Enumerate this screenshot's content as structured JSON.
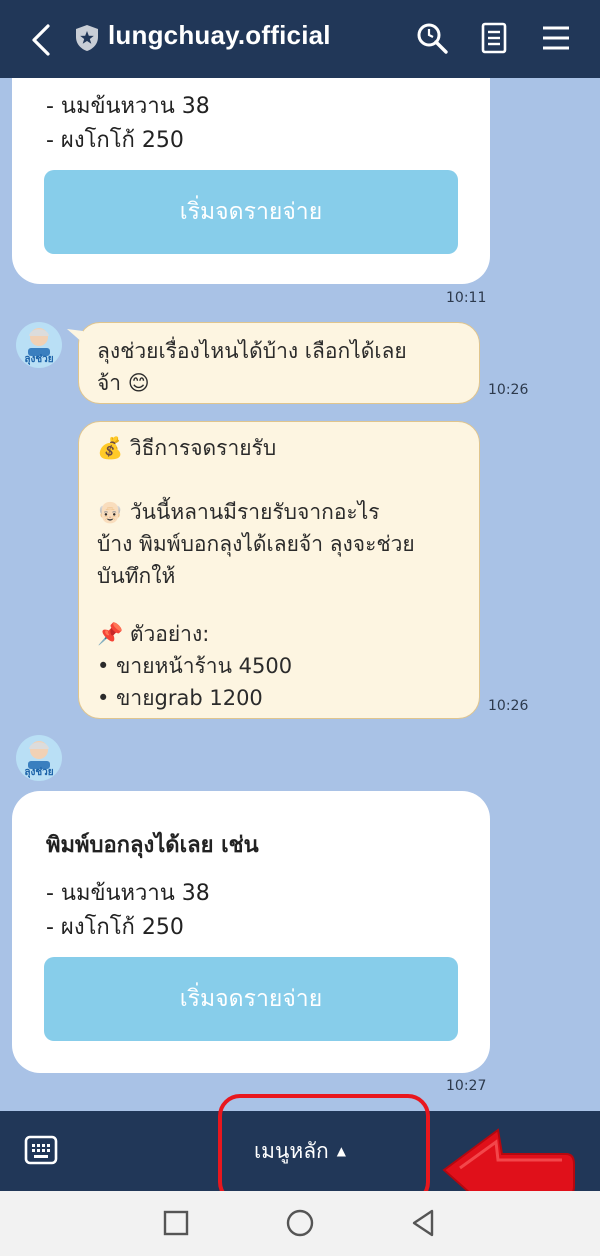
{
  "header": {
    "account_name": "lungchuay.official"
  },
  "messages": {
    "card_top": {
      "lines": [
        "- นมข้นหวาน 38",
        "- ผงโกโก้ 250"
      ],
      "button_label": "เริ่มจดรายจ่าย",
      "time": "10:11"
    },
    "bubble1": {
      "lines": [
        "ลุงช่วยเรื่องไหนได้บ้าง เลือกได้เลย",
        "จ้า 😊"
      ],
      "time": "10:26"
    },
    "bubble2": {
      "lines": [
        "💰 วิธีการจดรายรับ",
        "",
        "👴🏻 วันนี้หลานมีรายรับจากอะไร",
        "บ้าง พิมพ์บอกลุงได้เลยจ้า ลุงจะช่วย",
        "บันทึกให้",
        "",
        "📌 ตัวอย่าง:",
        "• ขายหน้าร้าน 4500",
        "• ขายgrab 1200"
      ],
      "time": "10:26"
    },
    "card_bottom": {
      "heading": "พิมพ์บอกลุงได้เลย เช่น",
      "lines": [
        "- นมข้นหวาน 38",
        "- ผงโกโก้ 250"
      ],
      "button_label": "เริ่มจดรายจ่าย",
      "time": "10:27"
    },
    "avatar_label": "ลุงช่วย"
  },
  "bottom_bar": {
    "menu_label": "เมนูหลัก",
    "menu_arrow": "▲"
  },
  "colors": {
    "header_bg": "#213758",
    "chat_bg": "#a9c2e6",
    "button_bg": "#87cdea",
    "bubble_bg": "#fdf5e1",
    "highlight": "#e8171e"
  },
  "icons": [
    "back-icon",
    "shield-icon",
    "search-icon",
    "notes-icon",
    "menu-icon",
    "keyboard-icon",
    "square-icon",
    "circle-icon",
    "triangle-back-icon",
    "red-arrow-pointer"
  ]
}
